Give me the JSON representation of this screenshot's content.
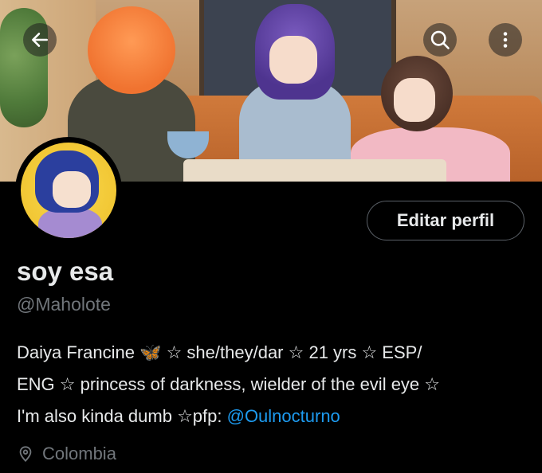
{
  "header": {
    "back_icon": "arrow-left-icon",
    "search_icon": "search-icon",
    "more_icon": "more-vertical-icon"
  },
  "profile": {
    "edit_button_label": "Editar perfil",
    "display_name": "soy esa",
    "handle": "@Maholote",
    "bio": {
      "line1_a": "Daiya Francine ",
      "butterfly": "🦋",
      "line1_b": " ☆ she/they/dar ☆ 21 yrs ☆ ESP/",
      "line2": "ENG ☆ princess of darkness, wielder of the evil eye ☆",
      "line3": "I'm also kinda dumb ☆pfp: ",
      "mention": "@Oulnocturno"
    },
    "location": "Colombia",
    "location_icon": "location-pin-icon"
  },
  "colors": {
    "background": "#000000",
    "text": "#e7e9ea",
    "secondary_text": "#71767b",
    "link": "#1d9bf0"
  }
}
